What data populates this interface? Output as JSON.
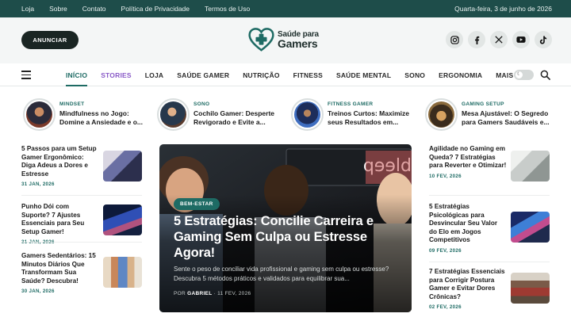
{
  "topbar": {
    "links": [
      "Loja",
      "Sobre",
      "Contato",
      "Política de Privacidade",
      "Termos de Uso"
    ],
    "date": "Quarta-feira, 3 de junho de 2026"
  },
  "header": {
    "advertise_label": "ANUNCIAR",
    "logo_line1": "Saúde para",
    "logo_line2": "Gamers",
    "socials": [
      "instagram-icon",
      "facebook-icon",
      "x-icon",
      "youtube-icon",
      "tiktok-icon"
    ]
  },
  "nav": {
    "items": [
      "INÍCIO",
      "STORIES",
      "LOJA",
      "SAÚDE GAMER",
      "NUTRIÇÃO",
      "FITNESS",
      "SAÚDE MENTAL",
      "SONO",
      "ERGONOMIA",
      "MAIS"
    ],
    "active": "INÍCIO"
  },
  "stories": [
    {
      "category": "MINDSET",
      "line1": "Mindfulness no Jogo:",
      "line2": "Domine a Ansiedade e o..."
    },
    {
      "category": "SONO",
      "line1": "Cochilo Gamer: Desperte",
      "line2": "Revigorado e Evite a..."
    },
    {
      "category": "FITNESS GAMER",
      "line1": "Treinos Curtos: Maximize",
      "line2": "seus Resultados em..."
    },
    {
      "category": "GAMING SETUP",
      "line1": "Mesa Ajustável: O Segredo",
      "line2": "para Gamers Saudáveis e..."
    }
  ],
  "left_list": [
    {
      "title": "5 Passos para um Setup Gamer Ergonômico: Diga Adeus a Dores e Estresse",
      "date": "31 JAN, 2026"
    },
    {
      "title": "Punho Dói com Suporte? 7 Ajustes Essenciais para Seu Setup Gamer!",
      "date": "31 JAN, 2026"
    },
    {
      "title": "Gamers Sedentários: 15 Minutos Diários Que Transformam Sua Saúde? Descubra!",
      "date": "30 JAN, 2026"
    }
  ],
  "right_list": [
    {
      "title": "Agilidade no Gaming em Queda? 7 Estratégias para Reverter e Otimizar!",
      "date": "10 FEV, 2026"
    },
    {
      "title": "5 Estratégias Psicológicas para Desvincular Seu Valor do Elo em Jogos Competitivos",
      "date": "09 FEV, 2026"
    },
    {
      "title": "7 Estratégias Essenciais para Corrigir Postura Gamer e Evitar Dores Crônicas?",
      "date": "02 FEV, 2026"
    }
  ],
  "hero": {
    "badge": "BEM-ESTAR",
    "title": "5 Estratégias: Concilie Carreira e Gaming Sem Culpa ou Estresse Agora!",
    "excerpt": "Sente o peso de conciliar vida profissional e gaming sem culpa ou estresse? Descubra 5 métodos práticos e validados para equilibrar sua...",
    "author_prefix": "POR",
    "author": "GABRIEL",
    "date": "11 FEV, 2026",
    "screen_text": "bleep"
  },
  "colors": {
    "topbar": "#1e4d4a",
    "accent": "#1e6b64",
    "stories": "#8a5bc8",
    "header_bg": "#f4f6f6"
  }
}
